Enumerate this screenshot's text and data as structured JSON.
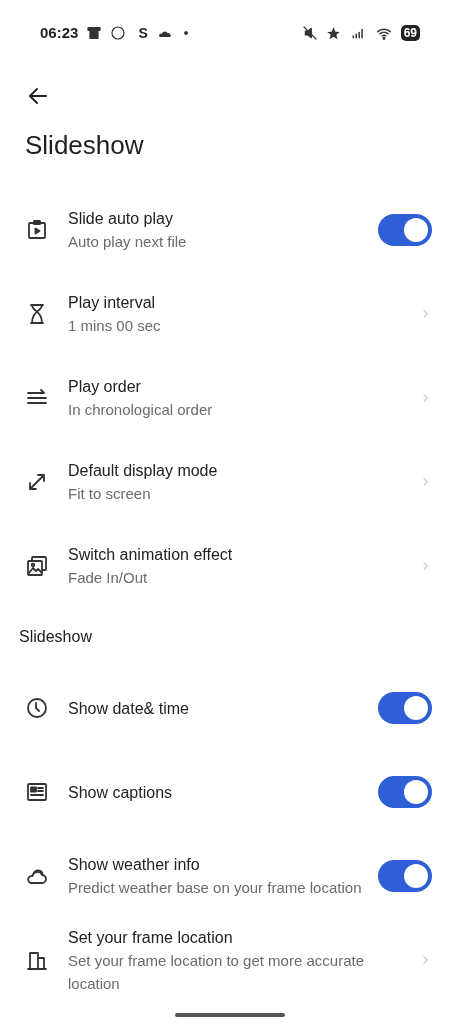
{
  "status_bar": {
    "time": "06:23",
    "notification_letter": "S",
    "battery": "69"
  },
  "page": {
    "title": "Slideshow"
  },
  "settings": [
    {
      "title": "Slide auto play",
      "subtitle": "Auto play next file",
      "kind": "toggle",
      "on": true
    },
    {
      "title": "Play interval",
      "subtitle": "1 mins 00 sec",
      "kind": "link"
    },
    {
      "title": "Play order",
      "subtitle": "In chronological order",
      "kind": "link"
    },
    {
      "title": "Default display mode",
      "subtitle": "Fit to screen",
      "kind": "link"
    },
    {
      "title": "Switch animation effect",
      "subtitle": "Fade In/Out",
      "kind": "link"
    }
  ],
  "section": {
    "title": "Slideshow",
    "settings": [
      {
        "title": "Show date& time",
        "kind": "toggle",
        "on": true
      },
      {
        "title": "Show captions",
        "kind": "toggle",
        "on": true
      },
      {
        "title": "Show weather info",
        "subtitle": "Predict weather base on your frame location",
        "kind": "toggle",
        "on": true
      },
      {
        "title": "Set your frame location",
        "subtitle": "Set your frame location to get more accurate location",
        "kind": "link"
      }
    ]
  }
}
